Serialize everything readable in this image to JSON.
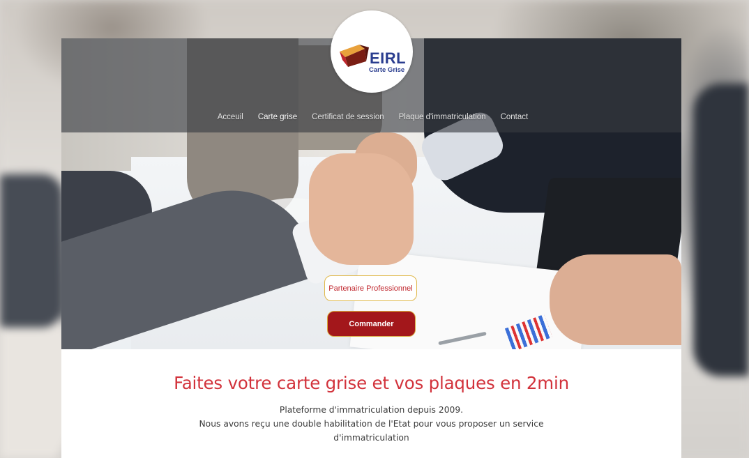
{
  "logo": {
    "brand": "EIRL",
    "subtitle": "Carte Grise"
  },
  "nav": {
    "items": [
      {
        "label": "Acceuil",
        "active": false
      },
      {
        "label": "Carte grise",
        "active": true
      },
      {
        "label": "Certificat de session",
        "active": false
      },
      {
        "label": "Plaque d'immatriculation",
        "active": false
      },
      {
        "label": "Contact",
        "active": false
      }
    ]
  },
  "hero": {
    "partner_button": "Partenaire Professionnel",
    "order_button": "Commander"
  },
  "intro": {
    "headline": "Faites votre carte grise et vos plaques en 2min",
    "line1": "Plateforme d'immatriculation depuis 2009.",
    "line2": "Nous avons reçu une double habilitation de l'Etat pour vous proposer un service d'immatriculation"
  },
  "colors": {
    "accent_red": "#d2323b",
    "button_red": "#a3171b",
    "button_border_gold": "#e0b84a",
    "logo_blue": "#2a3d8f"
  }
}
